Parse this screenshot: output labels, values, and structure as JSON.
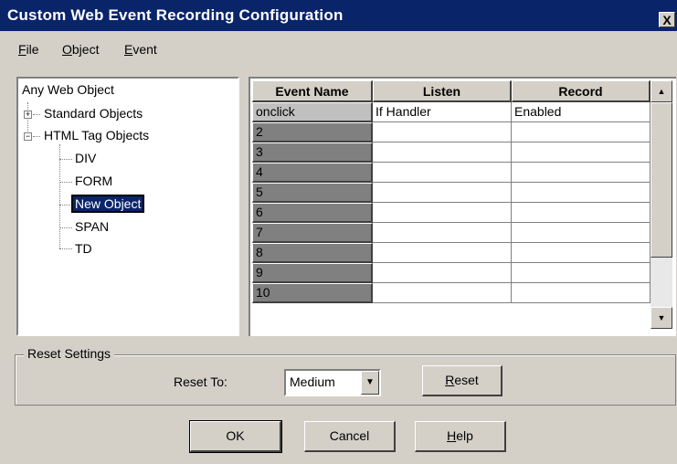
{
  "window": {
    "title": "Custom Web Event Recording Configuration",
    "close_glyph": "X"
  },
  "menu": {
    "items": [
      {
        "accel": "F",
        "rest": "ile"
      },
      {
        "accel": "O",
        "rest": "bject"
      },
      {
        "accel": "E",
        "rest": "vent"
      }
    ]
  },
  "tree": {
    "root": "Any Web Object",
    "standard": "Standard Objects",
    "html": "HTML Tag Objects",
    "children": [
      "DIV",
      "FORM",
      "New Object",
      "SPAN",
      "TD"
    ],
    "selected": "New Object"
  },
  "grid": {
    "columns": [
      "Event Name",
      "Listen",
      "Record"
    ],
    "rows": [
      {
        "name": "onclick",
        "listen": "If Handler",
        "record": "Enabled"
      },
      {
        "name": "2",
        "listen": "",
        "record": ""
      },
      {
        "name": "3",
        "listen": "",
        "record": ""
      },
      {
        "name": "4",
        "listen": "",
        "record": ""
      },
      {
        "name": "5",
        "listen": "",
        "record": ""
      },
      {
        "name": "6",
        "listen": "",
        "record": ""
      },
      {
        "name": "7",
        "listen": "",
        "record": ""
      },
      {
        "name": "8",
        "listen": "",
        "record": ""
      },
      {
        "name": "9",
        "listen": "",
        "record": ""
      },
      {
        "name": "10",
        "listen": "",
        "record": ""
      }
    ]
  },
  "reset": {
    "group_title": "Reset Settings",
    "reset_to_label": "Reset To:",
    "level_value": "Medium",
    "reset_button": {
      "accel": "R",
      "rest": "eset"
    }
  },
  "buttons": {
    "ok": "OK",
    "cancel": "Cancel",
    "help": {
      "accel": "H",
      "rest": "elp"
    }
  }
}
